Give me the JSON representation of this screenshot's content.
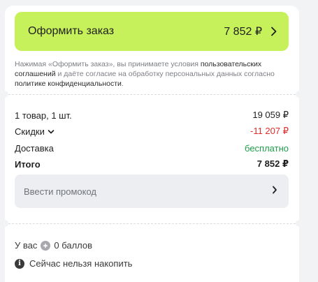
{
  "checkout": {
    "label": "Оформить заказ",
    "price": "7 852 ₽",
    "chevron_icon": "chevron-right-icon",
    "color": "#c6f15a"
  },
  "legal": {
    "part1": "Нажимая «Оформить заказ», вы принимаете условия ",
    "link1": "пользовательских соглашений",
    "part2": " и даёте согласие на обработку персональных данных согласно ",
    "link2": "политике конфиденциальности",
    "part3": "."
  },
  "summary": {
    "items_label": "1 товар, 1 шт.",
    "items_value": "19 059 ₽",
    "discount_label": "Скидки",
    "discount_value": "-11 207 ₽",
    "delivery_label": "Доставка",
    "delivery_value": "бесплатно",
    "total_label": "Итого",
    "total_value": "7 852 ₽"
  },
  "promo": {
    "placeholder": "Ввести промокод",
    "chevron_icon": "chevron-right-icon"
  },
  "bonus": {
    "prefix": "У вас",
    "points": "0 баллов",
    "icon": "coin-icon"
  },
  "hint": {
    "text": "Сейчас нельзя накопить",
    "icon": "info-icon"
  },
  "colors": {
    "accent": "#c6f15a",
    "discount": "#e02c2c",
    "free_delivery": "#1f9e4a"
  }
}
